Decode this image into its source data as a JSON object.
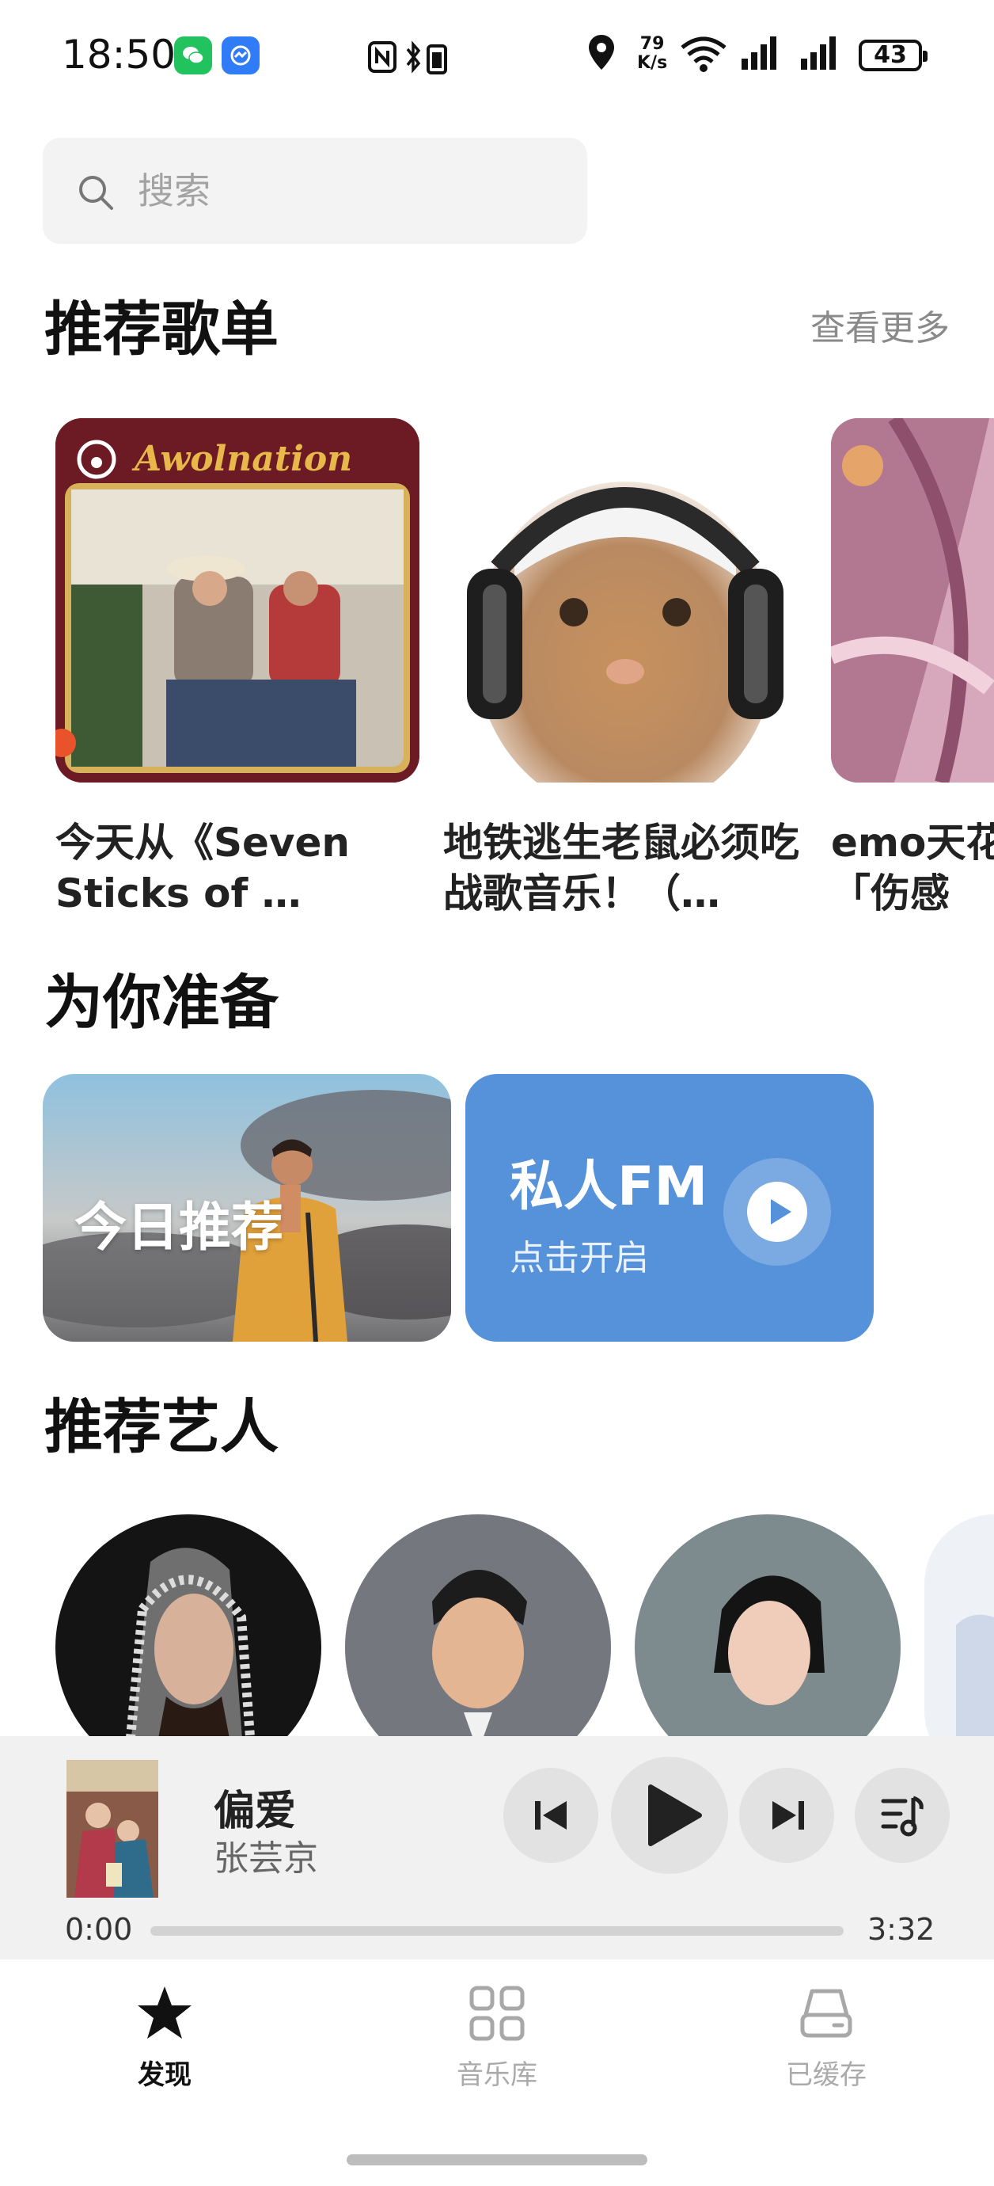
{
  "status_bar": {
    "time": "18:50",
    "net_speed_value": "79",
    "net_speed_unit": "K/s",
    "battery": "43"
  },
  "search": {
    "placeholder": "搜索"
  },
  "playlists_section": {
    "title": "推荐歌单",
    "more": "查看更多",
    "items": [
      {
        "title": "今天从《Seven Sticks of …",
        "cover_text": "Awolnation"
      },
      {
        "title": "地铁逃生老鼠必须吃战歌音乐！（…"
      },
      {
        "title": "emo天花板系列「伤感"
      }
    ]
  },
  "prepared_section": {
    "title": "为你准备",
    "daily": {
      "label": "今日推荐"
    },
    "fm": {
      "title": "私人FM",
      "subtitle": "点击开启"
    }
  },
  "artists_section": {
    "title": "推荐艺人"
  },
  "now_playing": {
    "title": "偏爱",
    "artist": "张芸京",
    "position": "0:00",
    "duration": "3:32",
    "progress": 0.0
  },
  "bottom_nav": {
    "items": [
      {
        "label": "发现",
        "icon": "star-icon",
        "active": true
      },
      {
        "label": "音乐库",
        "icon": "grid-icon",
        "active": false
      },
      {
        "label": "已缓存",
        "icon": "storage-icon",
        "active": false
      }
    ]
  },
  "colors": {
    "accent": "#4f8ed8",
    "text": "#111111",
    "muted": "#8a8a8a"
  }
}
